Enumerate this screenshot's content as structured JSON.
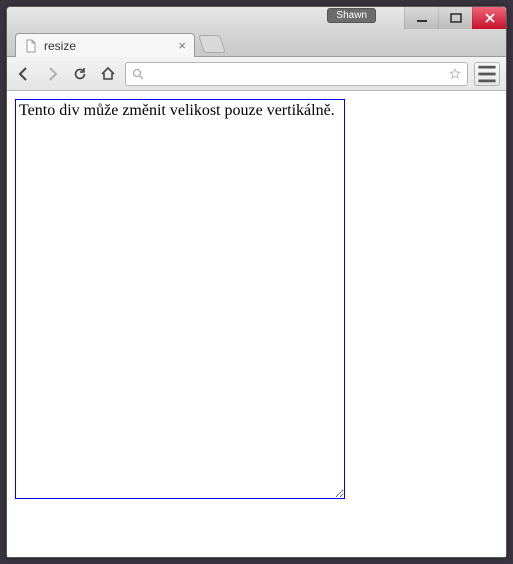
{
  "window": {
    "user_label": "Shawn"
  },
  "tab": {
    "title": "resize"
  },
  "toolbar": {
    "url": ""
  },
  "page": {
    "box_text": "Tento div může změnit velikost pouze vertikálně."
  }
}
